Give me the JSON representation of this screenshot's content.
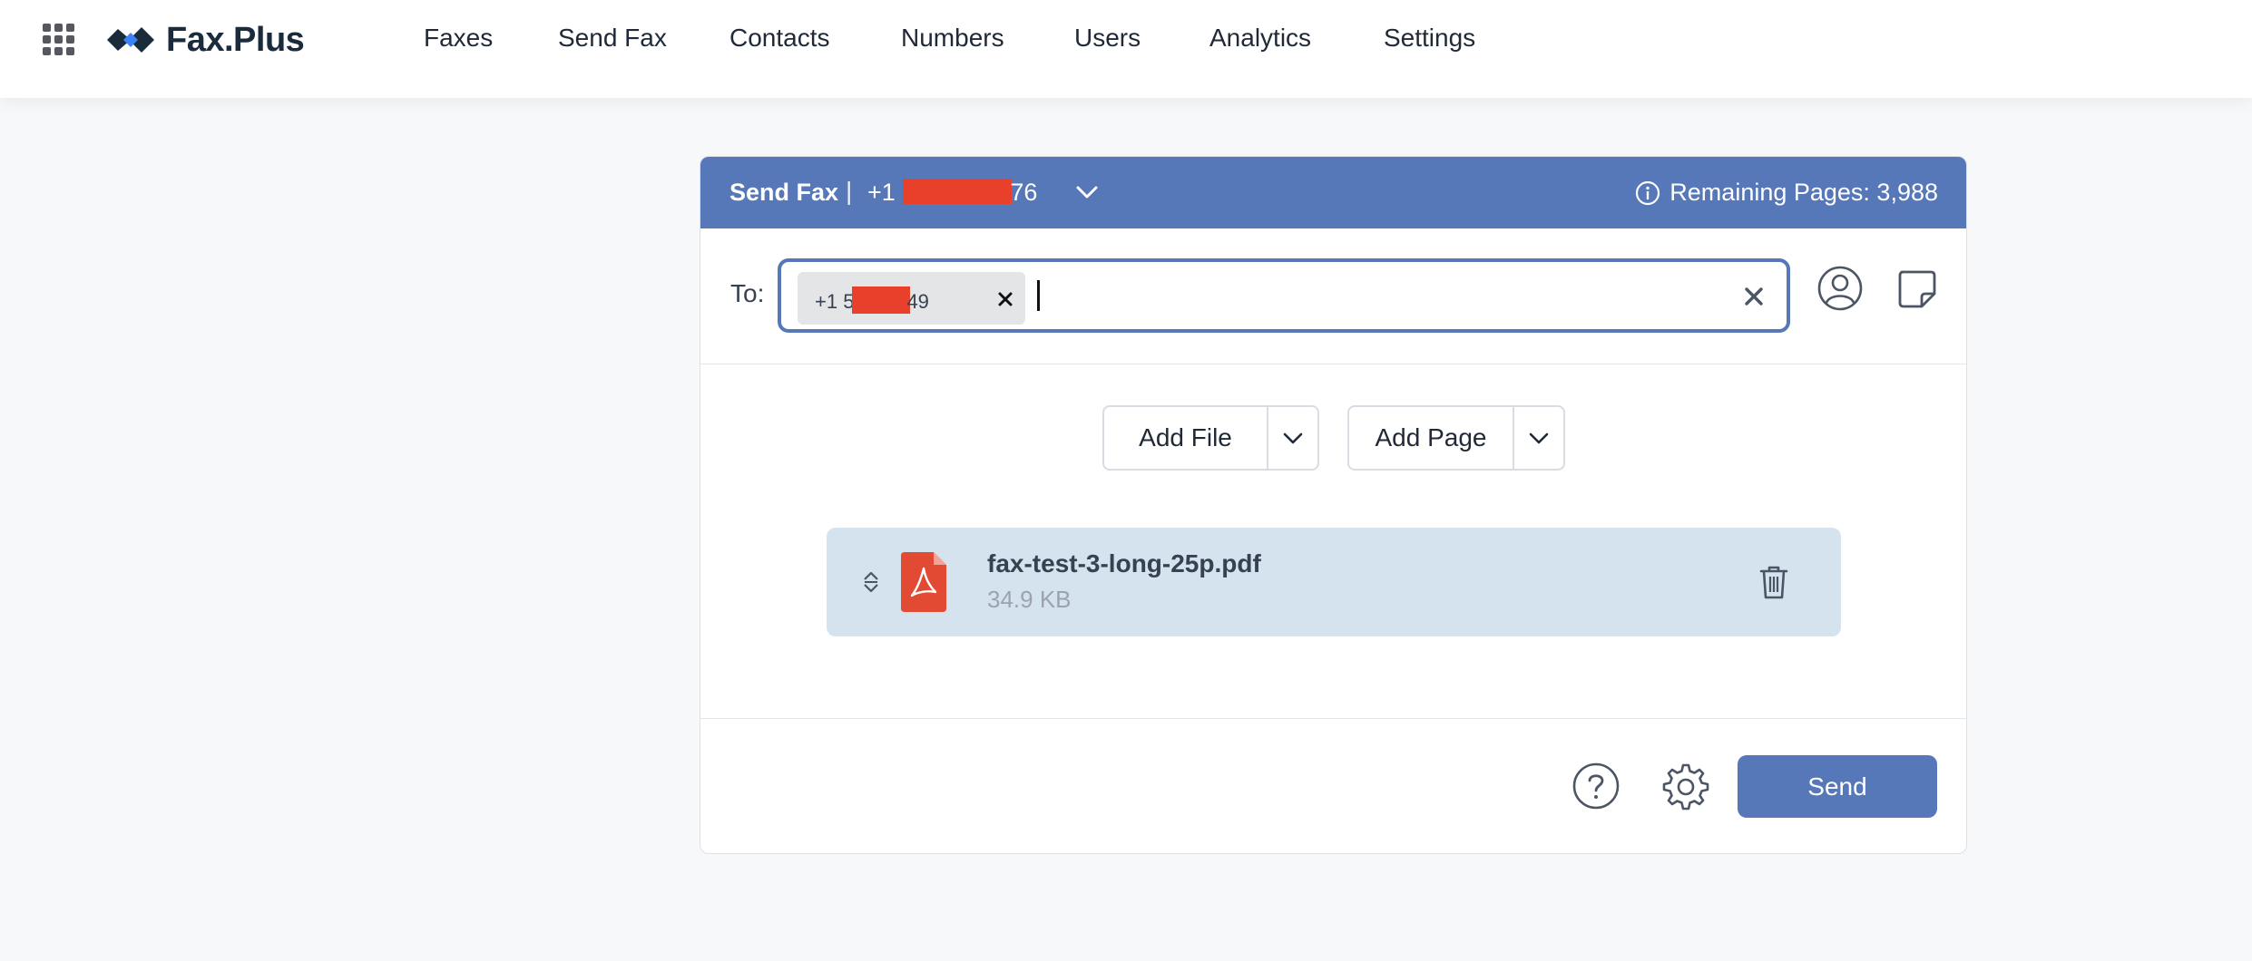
{
  "nav": {
    "logo_text": "Fax.Plus",
    "items": [
      {
        "label": "Faxes"
      },
      {
        "label": "Send Fax"
      },
      {
        "label": "Contacts"
      },
      {
        "label": "Numbers"
      },
      {
        "label": "Users"
      },
      {
        "label": "Analytics"
      },
      {
        "label": "Settings"
      }
    ]
  },
  "send_fax": {
    "title": "Send Fax",
    "separator": "|",
    "from_number_prefix": "+1 6",
    "from_number_suffix": "76",
    "remaining_pages": "Remaining Pages: 3,988",
    "to_label": "To:",
    "recipient_prefix": "+1 5",
    "recipient_suffix": "49",
    "add_file_label": "Add File",
    "add_page_label": "Add Page",
    "file": {
      "name": "fax-test-3-long-25p.pdf",
      "size": "34.9 KB"
    },
    "send_label": "Send"
  },
  "colors": {
    "accent": "#5677b8",
    "redaction": "#e8402b",
    "file_bg": "#d5e3ef",
    "pdf_red": "#e34a34"
  },
  "icons": [
    "apps-grid-icon",
    "logo-icon",
    "chevron-down-icon",
    "info-icon",
    "close-icon",
    "contact-icon",
    "note-icon",
    "drag-sort-icon",
    "pdf-file-icon",
    "trash-icon",
    "help-icon",
    "gear-icon"
  ]
}
